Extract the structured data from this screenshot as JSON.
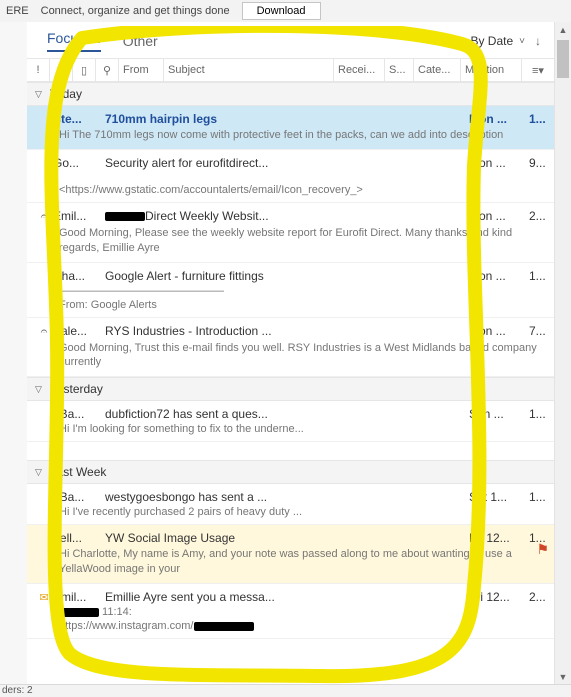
{
  "ribbon": {
    "frag_left": "ERE",
    "tagline": "Connect, organize and get things done",
    "download": "Download"
  },
  "tabs": {
    "focused": "Focused",
    "other": "Other",
    "sort_label": "By Date",
    "sort_chev": "˅",
    "menu_arrow": "↓"
  },
  "columns": {
    "importance": "!",
    "from": "From",
    "subject": "Subject",
    "received": "Recei...",
    "size": "S...",
    "categories": "Cate...",
    "mention": "Mention"
  },
  "groups": {
    "today": "Today",
    "yesterday": "Yesterday",
    "lastweek": "Last Week"
  },
  "messages": {
    "m1": {
      "from": "Ste...",
      "subject": "710mm hairpin legs",
      "received": "Mon ...",
      "count": "1...",
      "preview": "Hi  The 710mm legs now come with protective feet in the packs, can we add into description"
    },
    "m2": {
      "from": "Go...",
      "subject": "Security alert for eurofitdirect...",
      "received": "Mon ...",
      "count": "9...",
      "preview": "<https://www.gstatic.com/accountalerts/email/Icon_recovery_>"
    },
    "m3": {
      "from": "Emil...",
      "subject_suffix": "Direct Weekly Websit...",
      "received": "Mon ...",
      "count": "2...",
      "preview": "Good Morning,  Please see the weekly website report for Eurofit Direct.    Many thanks and kind regards,   Emillie Ayre"
    },
    "m4": {
      "from": "Cha...",
      "subject": "Google Alert - furniture fittings",
      "received": "Mon ...",
      "count": "1...",
      "preview_rule": "———————————————",
      "preview": "From: Google Alerts"
    },
    "m5": {
      "from": "Sale...",
      "subject": "RYS Industries - Introduction ...",
      "received": "Mon ...",
      "count": "7...",
      "preview": "Good Morning,  Trust this e-mail finds you well.     RSY Industries is a West Midlands based company currently"
    },
    "m6": {
      "from": "eBa...",
      "subject": "dubfiction72 has sent a ques...",
      "received": "Sun ...",
      "count": "1...",
      "preview": "Hi I'm looking for something to fix to the underne..."
    },
    "m7": {
      "from": "eBa...",
      "subject": "westygoesbongo has sent a ...",
      "received": "Sat 1...",
      "count": "1...",
      "preview": "Hi I've recently purchased 2 pairs of heavy duty ..."
    },
    "m8": {
      "from": "Yell...",
      "subject": "YW Social Image Usage",
      "received": "Fri 12...",
      "count": "1...",
      "preview": "Hi Charlotte,  My name is Amy, and your note was passed along to me about wanting to use a YellaWood image in your"
    },
    "m9": {
      "from": "Emil...",
      "subject": "Emillie Ayre sent you a messa...",
      "received": "Fri 12...",
      "count": "2...",
      "preview_time": " 11:14:",
      "preview_url": "https://www.instagram.com/"
    }
  },
  "status": {
    "text": "ders: 2"
  },
  "icons": {
    "reminder": "🔔",
    "attach": "📎",
    "flag": "⚑",
    "envelope": "✉",
    "reply": "↩",
    "filter": "▾"
  }
}
